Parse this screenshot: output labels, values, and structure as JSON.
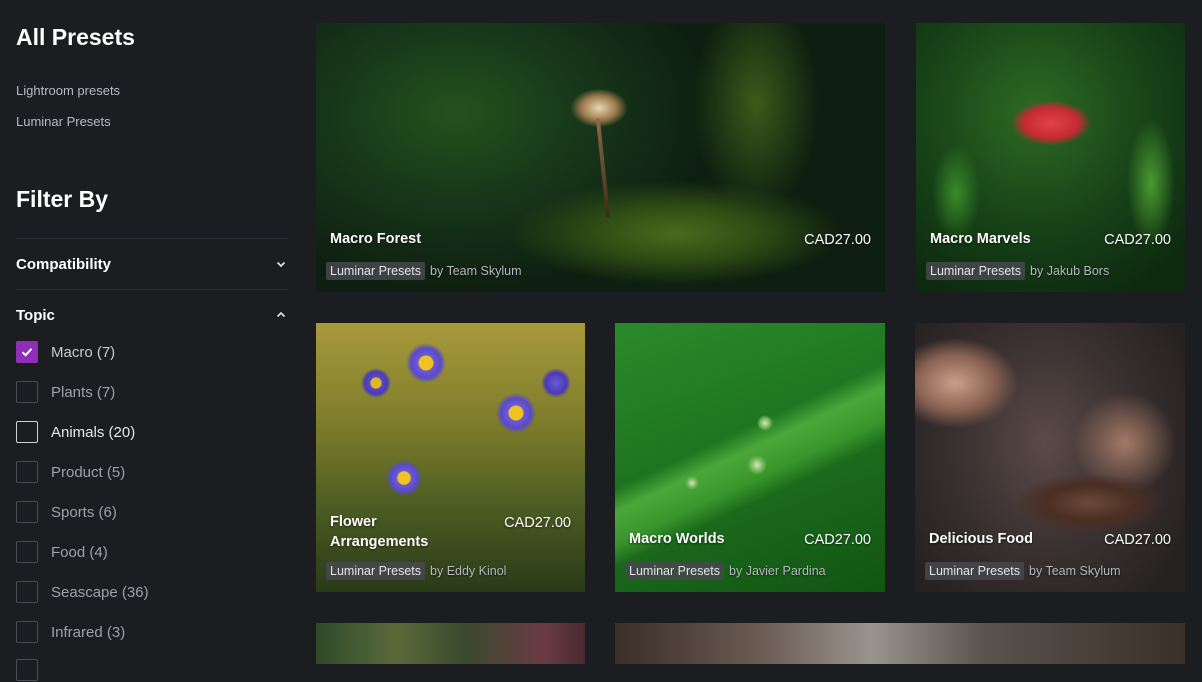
{
  "sidebar": {
    "title": "All Presets",
    "preset_links": [
      "Lightroom presets",
      "Luminar Presets"
    ],
    "filter_title": "Filter By",
    "compatibility_label": "Compatibility",
    "topic_label": "Topic",
    "topics": [
      {
        "label": "Macro (7)",
        "checked": true
      },
      {
        "label": "Plants (7)",
        "checked": false
      },
      {
        "label": "Animals (20)",
        "checked": false
      },
      {
        "label": "Product (5)",
        "checked": false
      },
      {
        "label": "Sports (6)",
        "checked": false
      },
      {
        "label": "Food (4)",
        "checked": false
      },
      {
        "label": "Seascape (36)",
        "checked": false
      },
      {
        "label": "Infrared (3)",
        "checked": false
      }
    ]
  },
  "cards": [
    {
      "title": "Macro Forest",
      "price": "CAD27.00",
      "tag": "Luminar Presets",
      "author": "by Team Skylum"
    },
    {
      "title": "Macro Marvels",
      "price": "CAD27.00",
      "tag": "Luminar Presets",
      "author": "by Jakub Bors"
    },
    {
      "title_line1": "Flower",
      "title_line2": "Arrangements",
      "price": "CAD27.00",
      "tag": "Luminar Presets",
      "author": "by Eddy Kinol"
    },
    {
      "title": "Macro Worlds",
      "price": "CAD27.00",
      "tag": "Luminar Presets",
      "author": "by Javier Pardina"
    },
    {
      "title": "Delicious Food",
      "price": "CAD27.00",
      "tag": "Luminar Presets",
      "author": "by Team Skylum"
    }
  ],
  "colors": {
    "background": "#1b1d21",
    "checkbox_checked": "#8f2fb8"
  },
  "icons": {
    "compatibility_toggle": "chevron-down-icon",
    "topic_toggle": "chevron-up-icon",
    "checkbox_check": "check-icon"
  }
}
